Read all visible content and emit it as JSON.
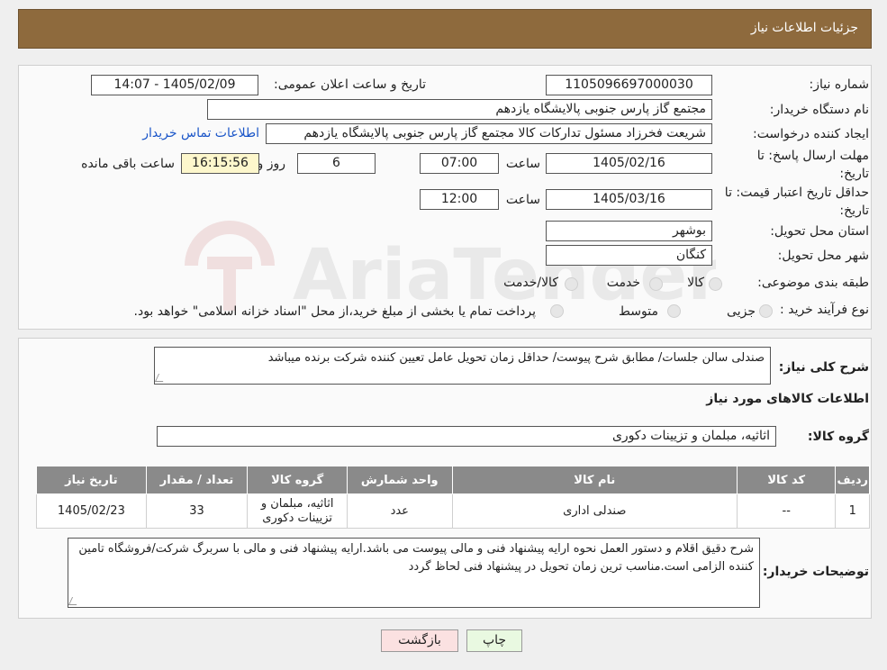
{
  "header": {
    "title": "جزئیات اطلاعات نیاز"
  },
  "watermark": {
    "text": "AriaTender.neT"
  },
  "fields": {
    "need_number": {
      "label": "شماره نیاز:",
      "value": "1105096697000030"
    },
    "announce": {
      "label": "تاریخ و ساعت اعلان عمومی:",
      "value": "1405/02/09 - 14:07"
    },
    "buyer_org": {
      "label": "نام دستگاه خریدار:",
      "value": "مجتمع گاز پارس جنوبی  پالایشگاه یازدهم"
    },
    "requester": {
      "label": "ایجاد کننده درخواست:",
      "value": "شریعت فخرزاد مسئول تدارکات کالا مجتمع گاز پارس جنوبی  پالایشگاه یازدهم",
      "contact_link": "اطلاعات تماس خریدار"
    },
    "deadline": {
      "label_line1": "مهلت ارسال پاسخ: تا",
      "label_line2": "تاریخ:",
      "date": "1405/02/16",
      "time_label": "ساعت",
      "time": "07:00",
      "days": "6",
      "days_label": "روز و",
      "remaining": "16:15:56",
      "remaining_label": "ساعت باقی مانده"
    },
    "price_validity": {
      "label_line1": "حداقل تاریخ اعتبار قیمت: تا",
      "label_line2": "تاریخ:",
      "date": "1405/03/16",
      "time_label": "ساعت",
      "time": "12:00"
    },
    "province": {
      "label": "استان محل تحویل:",
      "value": "بوشهر"
    },
    "city": {
      "label": "شهر محل تحویل:",
      "value": "کنگان"
    },
    "category": {
      "label": "طبقه بندی موضوعی:",
      "options": [
        "کالا",
        "خدمت",
        "کالا/خدمت"
      ]
    },
    "purchase_type": {
      "label": "نوع فرآیند خرید :",
      "options": [
        "جزیی",
        "متوسط"
      ],
      "note": "پرداخت تمام یا بخشی از مبلغ خرید،از محل \"اسناد خزانه اسلامی\" خواهد بود."
    }
  },
  "summary": {
    "label": "شرح کلی نیاز:",
    "value": "صندلی سالن جلسات/ مطابق شرح پیوست/ حداقل زمان تحویل عامل تعیین کننده شرکت برنده میباشد"
  },
  "goods_section": {
    "title": "اطلاعات کالاهای مورد نیاز"
  },
  "goods_group": {
    "label": "گروه کالا:",
    "value": "اثاثیه، مبلمان و تزیینات دکوری"
  },
  "table": {
    "headers": [
      "ردیف",
      "کد کالا",
      "نام کالا",
      "واحد شمارش",
      "گروه کالا",
      "تعداد / مقدار",
      "تاریخ نیاز"
    ],
    "rows": [
      [
        "1",
        "--",
        "صندلی اداری",
        "عدد",
        "اثاثیه، مبلمان و تزیینات دکوری",
        "33",
        "1405/02/23"
      ]
    ]
  },
  "buyer_notes": {
    "label": "توضیحات خریدار:",
    "value": "شرح دقیق اقلام و دستور العمل نحوه ارایه پیشنهاد فنی و مالی پیوست می باشد.ارایه پیشنهاد فنی و مالی با سربرگ شرکت/فروشگاه تامین کننده الزامی است.مناسب ترین زمان تحویل در پیشنهاد فنی لحاظ گردد"
  },
  "buttons": {
    "print": "چاپ",
    "back": "بازگشت"
  },
  "colors": {
    "header_bg": "#8e6a3d",
    "print_btn": "#e9f9e1",
    "back_btn": "#fbe1e1",
    "remaining_bg": "#fdf7cc",
    "link": "#1a55c8"
  }
}
